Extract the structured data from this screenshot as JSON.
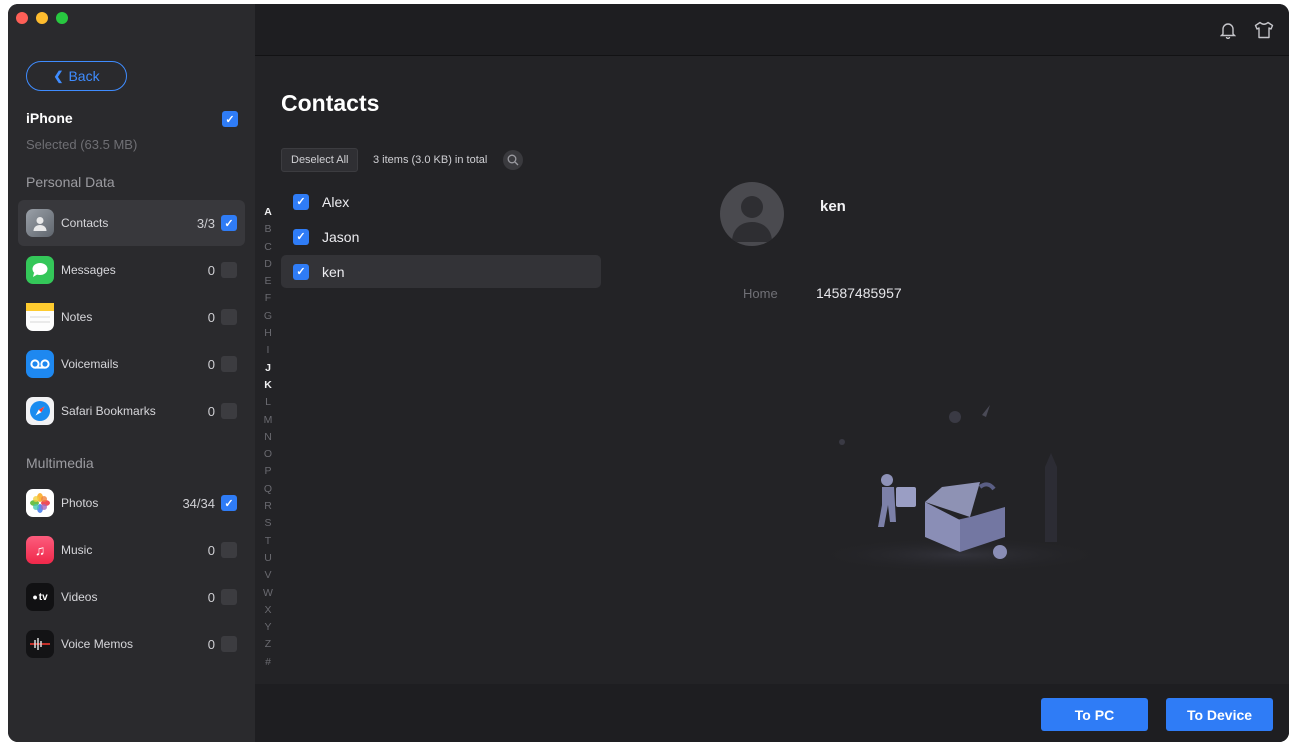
{
  "sidebar": {
    "back_label": "Back",
    "device": {
      "name": "iPhone",
      "selected": "Selected (63.5 MB)",
      "checked": true
    },
    "sections": {
      "personal": "Personal Data",
      "multimedia": "Multimedia"
    },
    "personal_items": [
      {
        "label": "Contacts",
        "count": "3/3",
        "checked": true,
        "icon": "contacts-icon",
        "active": true
      },
      {
        "label": "Messages",
        "count": "0",
        "checked": false,
        "icon": "messages-icon"
      },
      {
        "label": "Notes",
        "count": "0",
        "checked": false,
        "icon": "notes-icon"
      },
      {
        "label": "Voicemails",
        "count": "0",
        "checked": false,
        "icon": "voicemail-icon"
      },
      {
        "label": "Safari Bookmarks",
        "count": "0",
        "checked": false,
        "icon": "safari-icon"
      }
    ],
    "multimedia_items": [
      {
        "label": "Photos",
        "count": "34/34",
        "checked": true,
        "icon": "photos-icon"
      },
      {
        "label": "Music",
        "count": "0",
        "checked": false,
        "icon": "music-icon"
      },
      {
        "label": "Videos",
        "count": "0",
        "checked": false,
        "icon": "appletv-icon",
        "icon_text": "tv"
      },
      {
        "label": "Voice Memos",
        "count": "0",
        "checked": false,
        "icon": "voice-memos-icon"
      }
    ]
  },
  "topbar": {
    "icons": [
      "bell-icon",
      "shirt-icon"
    ]
  },
  "main": {
    "title": "Contacts",
    "deselect_label": "Deselect All",
    "summary": "3 items (3.0 KB) in total",
    "alphabet": [
      "A",
      "B",
      "C",
      "D",
      "E",
      "F",
      "G",
      "H",
      "I",
      "J",
      "K",
      "L",
      "M",
      "N",
      "O",
      "P",
      "Q",
      "R",
      "S",
      "T",
      "U",
      "V",
      "W",
      "X",
      "Y",
      "Z",
      "#"
    ],
    "alphabet_available": [
      "A",
      "J",
      "K"
    ],
    "contacts": [
      {
        "name": "Alex",
        "checked": true,
        "selected": false
      },
      {
        "name": "Jason",
        "checked": true,
        "selected": false
      },
      {
        "name": "ken",
        "checked": true,
        "selected": true
      }
    ],
    "detail": {
      "name": "ken",
      "label": "Home",
      "value": "14587485957"
    }
  },
  "buttons": {
    "to_pc": "To PC",
    "to_device": "To Device"
  },
  "colors": {
    "accent": "#2f7cf6",
    "sidebar": "#2a2a2d",
    "background": "#232326"
  }
}
